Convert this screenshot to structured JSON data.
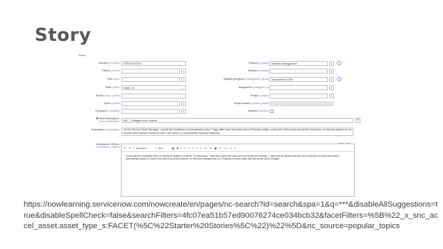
{
  "slide": {
    "title": "Story",
    "url": "https://nowlearning.servicenow.com/nowcreate/en/pages/nc-search?id=search&spa=1&q=***&disableAllSuggestions=true&disableSpellCheck=false&searchFilters=4fc07ea51b57ed90076274ce034bcb32&facetFilters=%5B%22_x_snc_accel_asset.asset_type_s:FACET(%5C%22Starter%20Stories%5C%22)%22%5D&nc_source=popular_topics"
  },
  "form": {
    "table_name": "Scrum",
    "left_fields": [
      {
        "label": "Number",
        "column": "number",
        "value": "STRY0010799"
      },
      {
        "label": "Theme",
        "column": "theme",
        "value": ""
      },
      {
        "label": "Epic",
        "column": "epic",
        "value": ""
      },
      {
        "label": "State",
        "column": "state",
        "value": "Draft | -6"
      },
      {
        "label": "Points",
        "column": "story_points",
        "value": ""
      },
      {
        "label": "Sprint",
        "column": "sprint",
        "value": ""
      },
      {
        "label": "Company",
        "column": "company",
        "value": ""
      }
    ],
    "right_fields": [
      {
        "label": "Product",
        "column": "product",
        "value": "Incident Management"
      },
      {
        "label": "Release",
        "column": "release",
        "value": ""
      },
      {
        "label": "Assignment group",
        "column": "assignment_group",
        "value": "ServiceNow ITSM"
      },
      {
        "label": "Assigned to",
        "column": "assigned_to",
        "value": ""
      },
      {
        "label": "Project",
        "column": "project",
        "value": ""
      },
      {
        "label": "Project phase",
        "column": "project_phase",
        "value": ""
      },
      {
        "label": "Blocked",
        "column": "blocked",
        "value": ""
      }
    ],
    "short_description": {
      "label": "Short description",
      "column": "short_description",
      "value": "INC - Configure auto closure"
    },
    "description": {
      "label": "Description",
      "column": "description",
      "value": "As the Service Desk Manager, I would like Incidents to automatically close 7 days after they have been set to Resolved state, unless the Caller does accept the resolution, so that the system is not flooded with resolved incidents and I can report on successfully resolved Incidents."
    },
    "acceptance_criteria": {
      "label": "Acceptance criteria",
      "column": "acceptance_criteria",
      "font": "Verdana",
      "size": "8pt",
      "body": "I know that this is complete when, on setting an Incident to resolved, it is autoclosed 7 days later, unless the Caller does not accept the resolution, 7 days after an Incident has been set to Resolved the State field should automatically update to Closed if the State is currently Resolved. If it has been changed back to In Progress or another state then this should not be changed."
    }
  }
}
